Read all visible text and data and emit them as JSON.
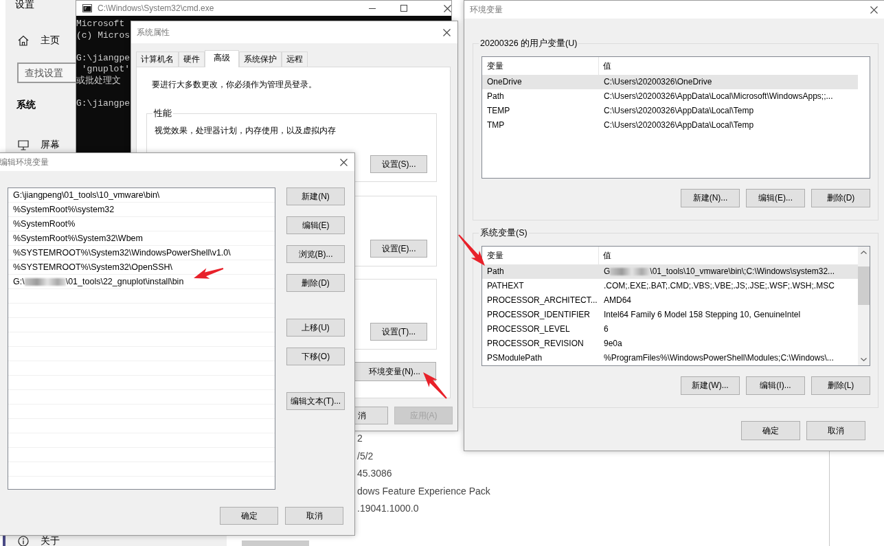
{
  "settings": {
    "title": "设置",
    "home_item": {
      "label": "主页",
      "kind": "home",
      "selected": false
    },
    "search": {
      "placeholder": "查找设置"
    },
    "section_title": "系统",
    "nav": [
      {
        "label": "屏幕",
        "kind": "monitor",
        "selected": false
      }
    ],
    "bottom_nav": [
      {
        "label": "关于",
        "kind": "info",
        "selected": true
      }
    ],
    "content_lines": [
      "2",
      "/5/2",
      "45.3086",
      "dows Feature Experience Pack",
      ".19041.1000.0"
    ]
  },
  "cmd": {
    "title": "C:\\Windows\\System32\\cmd.exe",
    "blocks": [
      {
        "lines": [
          "Microsoft",
          "(c) Micros"
        ]
      },
      {
        "lines": [
          "G:\\jiangpe",
          " 'gnuplot'",
          "或批处理文"
        ]
      },
      {
        "lines": [
          "G:\\jiangpe"
        ]
      }
    ]
  },
  "system_properties": {
    "title": "系统属性",
    "tabs": [
      {
        "label": "计算机名",
        "selected": false
      },
      {
        "label": "硬件",
        "selected": false
      },
      {
        "label": "高级",
        "selected": true
      },
      {
        "label": "系统保护",
        "selected": false
      },
      {
        "label": "远程",
        "selected": false
      }
    ],
    "notice": "要进行大多数更改，你必须作为管理员登录。",
    "groups": [
      {
        "label": "性能",
        "description": "视觉效果，处理器计划，内存使用，以及虚拟内存",
        "button": "设置(S)..."
      },
      {
        "button": "设置(E)..."
      },
      {
        "button": "设置(T)..."
      }
    ],
    "env_button": "环境变量(N)...",
    "footer_buttons": [
      {
        "label": "消",
        "disabled": false
      },
      {
        "label": "应用(A)",
        "disabled": true
      }
    ]
  },
  "environment_variables": {
    "title": "环境变量",
    "user_group": {
      "label": "20200326 的用户变量(U)",
      "columns": [
        "变量",
        "值"
      ],
      "rows": [
        {
          "name": "OneDrive",
          "value": "C:\\Users\\20200326\\OneDrive",
          "selected": true
        },
        {
          "name": "Path",
          "value": "C:\\Users\\20200326\\AppData\\Local\\Microsoft\\WindowsApps;;...",
          "selected": false
        },
        {
          "name": "TEMP",
          "value": "C:\\Users\\20200326\\AppData\\Local\\Temp",
          "selected": false
        },
        {
          "name": "TMP",
          "value": "C:\\Users\\20200326\\AppData\\Local\\Temp",
          "selected": false
        }
      ],
      "buttons": [
        "新建(N)...",
        "编辑(E)...",
        "删除(D)"
      ]
    },
    "system_group": {
      "label": "系统变量(S)",
      "columns": [
        "变量",
        "值"
      ],
      "rows": [
        {
          "name": "Path",
          "value_prefix": "G",
          "redacted": true,
          "value": "\\01_tools\\10_vmware\\bin\\;C:\\Windows\\system32...",
          "selected": true
        },
        {
          "name": "PATHEXT",
          "value": ".COM;.EXE;.BAT;.CMD;.VBS;.VBE;.JS;.JSE;.WSF;.WSH;.MSC",
          "selected": false
        },
        {
          "name": "PROCESSOR_ARCHITECT...",
          "value": "AMD64",
          "selected": false
        },
        {
          "name": "PROCESSOR_IDENTIFIER",
          "value": "Intel64 Family 6 Model 158 Stepping 10, GenuineIntel",
          "selected": false
        },
        {
          "name": "PROCESSOR_LEVEL",
          "value": "6",
          "selected": false
        },
        {
          "name": "PROCESSOR_REVISION",
          "value": "9e0a",
          "selected": false
        },
        {
          "name": "PSModulePath",
          "value": "%ProgramFiles%\\WindowsPowerShell\\Modules;C:\\Windows\\...",
          "selected": false
        }
      ],
      "buttons": [
        "新建(W)...",
        "编辑(I)...",
        "删除(L)"
      ]
    },
    "footer_buttons": [
      "确定",
      "取消"
    ]
  },
  "edit_dialog": {
    "title": "编辑环境变量",
    "items": [
      {
        "text": "G:\\jiangpeng\\01_tools\\10_vmware\\bin\\",
        "selected": false
      },
      {
        "text": "%SystemRoot%\\system32",
        "selected": false
      },
      {
        "text": "%SystemRoot%",
        "selected": false
      },
      {
        "text": "%SystemRoot%\\System32\\Wbem",
        "selected": false
      },
      {
        "text": "%SYSTEMROOT%\\System32\\WindowsPowerShell\\v1.0\\",
        "selected": false
      },
      {
        "text": "%SYSTEMROOT%\\System32\\OpenSSH\\",
        "selected": false
      },
      {
        "text_prefix": "G:\\",
        "redacted": true,
        "text": "\\01_tools\\22_gnuplot\\install\\bin",
        "selected": false
      }
    ],
    "side_button_groups": [
      [
        "新建(N)",
        "编辑(E)",
        "浏览(B)...",
        "删除(D)"
      ],
      [
        "上移(U)",
        "下移(O)"
      ],
      [
        "编辑文本(T)..."
      ]
    ],
    "footer_buttons": [
      "确定",
      "取消"
    ]
  }
}
